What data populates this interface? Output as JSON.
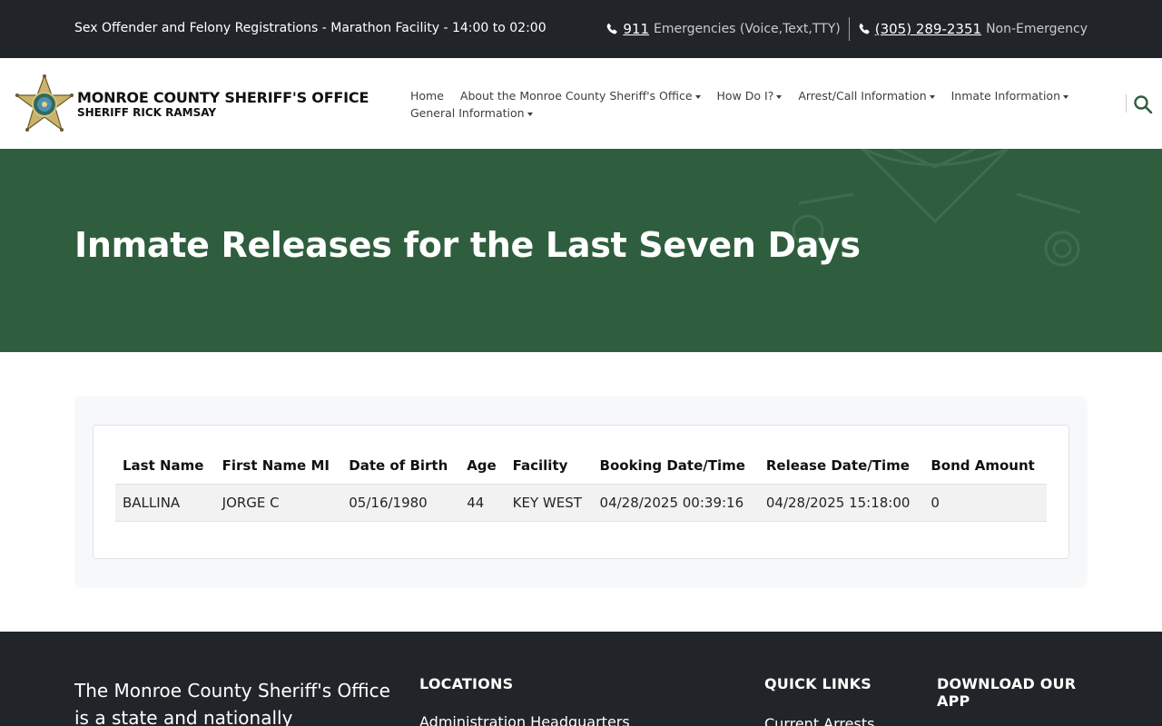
{
  "topbar": {
    "notice": "Sex Offender and Felony Registrations - Marathon Facility - 14:00 to 02:00",
    "emergency_number": "911",
    "emergency_label": "Emergencies (Voice,Text,TTY)",
    "nonemergency_number": "(305) 289-2351",
    "nonemergency_label": "Non-Emergency"
  },
  "brand": {
    "title": "MONROE COUNTY SHERIFF'S OFFICE",
    "subtitle": "SHERIFF RICK RAMSAY"
  },
  "nav": {
    "items": [
      {
        "label": "Home",
        "dropdown": false
      },
      {
        "label": "About the Monroe County Sheriff's Office",
        "dropdown": true
      },
      {
        "label": "How Do I?",
        "dropdown": true
      },
      {
        "label": "Arrest/Call Information",
        "dropdown": true
      },
      {
        "label": "Inmate Information",
        "dropdown": true
      },
      {
        "label": "General Information",
        "dropdown": true
      }
    ]
  },
  "hero": {
    "title": "Inmate Releases for the Last Seven Days"
  },
  "table": {
    "headers": [
      "Last Name",
      "First Name MI",
      "Date of Birth",
      "Age",
      "Facility",
      "Booking Date/Time",
      "Release Date/Time",
      "Bond Amount"
    ],
    "rows": [
      [
        "BALLINA",
        "JORGE C",
        "05/16/1980",
        "44",
        "KEY WEST",
        "04/28/2025 00:39:16",
        "04/28/2025 15:18:00",
        "0"
      ]
    ]
  },
  "footer": {
    "about": "The Monroe County Sheriff's Office is a state and nationally",
    "locations_heading": "LOCATIONS",
    "locations_first": "Administration Headquarters",
    "quicklinks_heading": "QUICK LINKS",
    "quicklinks_first": "Current Arrests",
    "app_heading": "DOWNLOAD OUR APP"
  },
  "colors": {
    "topbar_bg": "#212529",
    "hero_bg": "#2e5e3e",
    "accent_green": "#2e5e3e"
  }
}
